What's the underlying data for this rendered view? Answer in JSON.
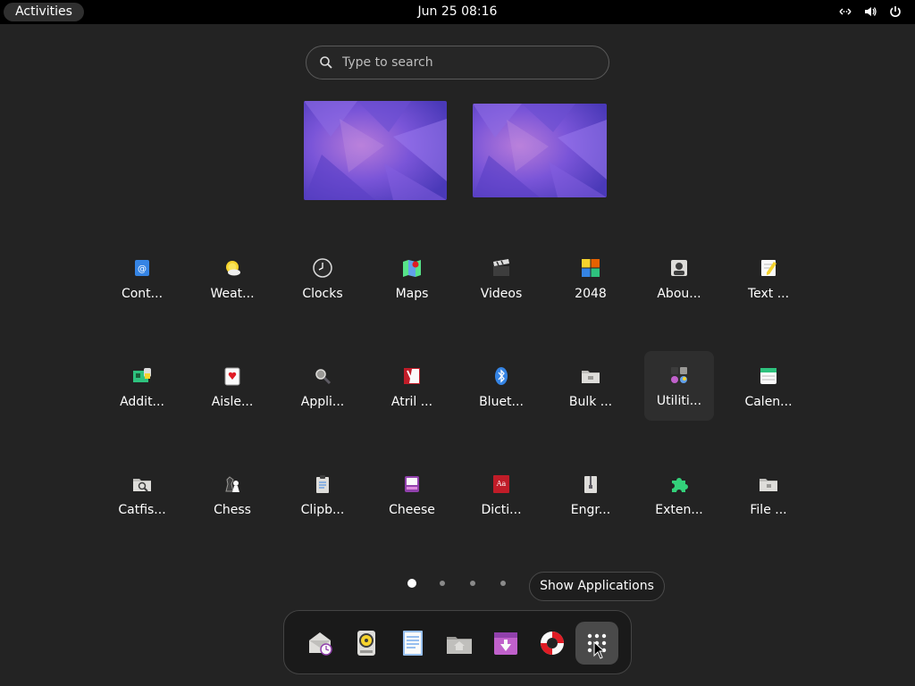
{
  "topbar": {
    "activities_label": "Activities",
    "clock": "Jun 25  08:16",
    "tray_icons": [
      "network-wired-icon",
      "volume-icon",
      "power-icon"
    ]
  },
  "search": {
    "placeholder": "Type to search"
  },
  "workspaces": 2,
  "apps": [
    {
      "label": "Cont...",
      "icon": "contacts-icon"
    },
    {
      "label": "Weat...",
      "icon": "weather-icon"
    },
    {
      "label": "Clocks",
      "icon": "clocks-icon"
    },
    {
      "label": "Maps",
      "icon": "maps-icon"
    },
    {
      "label": "Videos",
      "icon": "videos-icon"
    },
    {
      "label": "2048",
      "icon": "game-2048-icon"
    },
    {
      "label": "Abou...",
      "icon": "about-icon"
    },
    {
      "label": "Text ...",
      "icon": "text-editor-icon"
    },
    {
      "label": "Addit...",
      "icon": "additional-drivers-icon"
    },
    {
      "label": "Aisle...",
      "icon": "aisleriot-icon"
    },
    {
      "label": "Appli...",
      "icon": "application-finder-icon"
    },
    {
      "label": "Atril ...",
      "icon": "atril-icon"
    },
    {
      "label": "Bluet...",
      "icon": "bluetooth-icon"
    },
    {
      "label": "Bulk ...",
      "icon": "bulk-rename-icon"
    },
    {
      "label": "Utiliti...",
      "icon": "utilities-folder-icon"
    },
    {
      "label": "Calen...",
      "icon": "calendar-icon"
    },
    {
      "label": "Catfis...",
      "icon": "catfish-icon"
    },
    {
      "label": "Chess",
      "icon": "chess-icon"
    },
    {
      "label": "Clipb...",
      "icon": "clipboard-icon"
    },
    {
      "label": "Cheese",
      "icon": "cheese-icon"
    },
    {
      "label": "Dicti...",
      "icon": "dictionary-icon"
    },
    {
      "label": "Engr...",
      "icon": "engrampa-icon"
    },
    {
      "label": "Exten...",
      "icon": "extensions-icon"
    },
    {
      "label": "File ...",
      "icon": "file-manager-icon"
    }
  ],
  "pager": {
    "pages": 4,
    "current": 1
  },
  "tooltip": "Show Applications",
  "dash": [
    {
      "icon": "evolution-mail-icon"
    },
    {
      "icon": "rhythmbox-icon"
    },
    {
      "icon": "writer-document-icon"
    },
    {
      "icon": "files-home-icon"
    },
    {
      "icon": "software-install-icon"
    },
    {
      "icon": "help-lifebuoy-icon"
    },
    {
      "icon": "show-applications-icon"
    }
  ],
  "colors": {
    "background": "#232323",
    "topbar": "#000000",
    "accent_purple": "#7b5cd6"
  }
}
